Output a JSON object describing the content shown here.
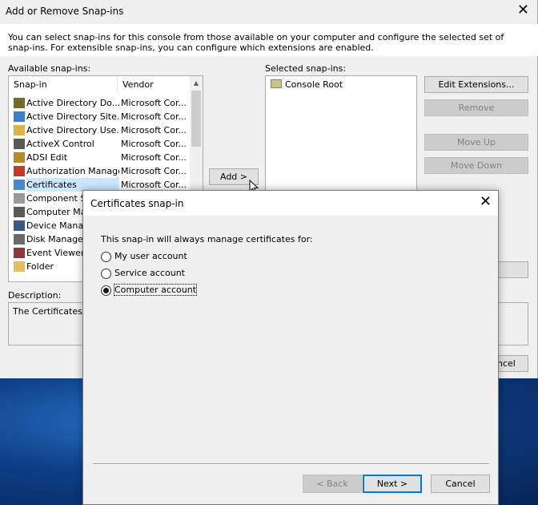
{
  "back_window": {
    "title": "Add or Remove Snap-ins",
    "close_glyph": "✕",
    "intro": "You can select snap-ins for this console from those available on your computer and configure the selected set of snap-ins. For extensible snap-ins, you can configure which extensions are enabled.",
    "available_label": "Available snap-ins:",
    "selected_label": "Selected snap-ins:",
    "columns": {
      "snapin": "Snap-in",
      "vendor": "Vendor"
    },
    "snapins": [
      {
        "name": "Active Directory Do...",
        "vendor": "Microsoft Cor...",
        "icon": "ad-domains-icon"
      },
      {
        "name": "Active Directory Site...",
        "vendor": "Microsoft Cor...",
        "icon": "ad-sites-icon"
      },
      {
        "name": "Active Directory Use...",
        "vendor": "Microsoft Cor...",
        "icon": "ad-users-icon"
      },
      {
        "name": "ActiveX Control",
        "vendor": "Microsoft Cor...",
        "icon": "activex-icon"
      },
      {
        "name": "ADSI Edit",
        "vendor": "Microsoft Cor...",
        "icon": "adsi-edit-icon"
      },
      {
        "name": "Authorization Manager",
        "vendor": "Microsoft Cor...",
        "icon": "authorization-icon"
      },
      {
        "name": "Certificates",
        "vendor": "Microsoft Cor...",
        "icon": "certificates-icon"
      },
      {
        "name": "Component Se",
        "vendor": "",
        "icon": "component-services-icon"
      },
      {
        "name": "Computer Man",
        "vendor": "",
        "icon": "computer-management-icon"
      },
      {
        "name": "Device Manage",
        "vendor": "",
        "icon": "device-manager-icon"
      },
      {
        "name": "Disk Manageme",
        "vendor": "",
        "icon": "disk-management-icon"
      },
      {
        "name": "Event Viewer",
        "vendor": "",
        "icon": "event-viewer-icon"
      },
      {
        "name": "Folder",
        "vendor": "",
        "icon": "folder-icon"
      }
    ],
    "selected_item": "Console Root",
    "add_button": "Add >",
    "edit_extensions_button": "Edit Extensions...",
    "remove_button": "Remove",
    "move_up_button": "Move Up",
    "move_down_button": "Move Down",
    "description_label": "Description:",
    "description_text": "The Certificates sn",
    "cancel_partial": "ncel"
  },
  "dialog": {
    "title": "Certificates snap-in",
    "close_glyph": "✕",
    "lead": "This snap-in will always manage certificates for:",
    "options": [
      {
        "label": "My user account",
        "checked": false
      },
      {
        "label": "Service account",
        "checked": false
      },
      {
        "label": "Computer account",
        "checked": true
      }
    ],
    "back_button": "< Back",
    "next_button": "Next >",
    "cancel_button": "Cancel"
  },
  "colors": {
    "dialog_bg": "#f0f0f0",
    "selection": "#cce8ff",
    "default_button_border": "#0078d7"
  }
}
